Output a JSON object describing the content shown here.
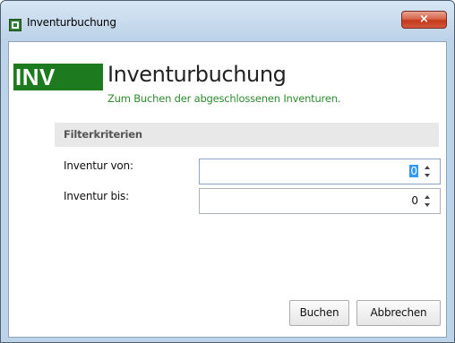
{
  "window": {
    "title": "Inventurbuchung",
    "close_label": "×"
  },
  "header": {
    "badge": "INV",
    "title": "Inventurbuchung",
    "subtitle": "Zum Buchen der abgeschlossenen Inventuren."
  },
  "filter": {
    "section_title": "Filterkriterien",
    "from_label": "Inventur von:",
    "from_value": "0",
    "to_label": "Inventur bis:",
    "to_value": "0"
  },
  "buttons": {
    "book_label": "Buchen",
    "cancel_label": "Abbrechen"
  },
  "colors": {
    "badge_bg": "#1e7a1e",
    "subtitle": "#2e8b2e",
    "selection": "#3399ff"
  }
}
